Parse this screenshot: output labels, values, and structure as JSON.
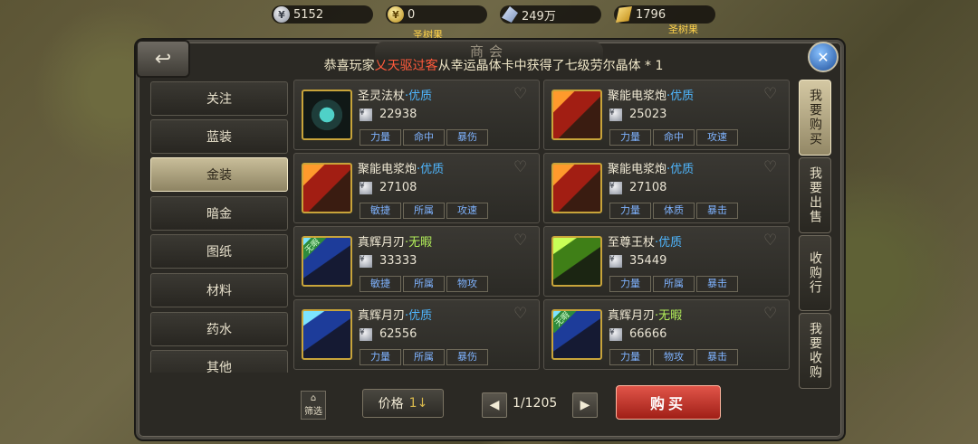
{
  "top_resources": [
    {
      "type": "silver",
      "value": "5152"
    },
    {
      "type": "gold",
      "value": "0"
    },
    {
      "type": "crystal",
      "value": "249万"
    },
    {
      "type": "goldbar",
      "value": "1796"
    }
  ],
  "labels": {
    "sacred_tree_left": "圣树果",
    "sacred_tree_right": "圣树果"
  },
  "panel": {
    "title": "商会",
    "announcement_prefix": "恭喜玩家",
    "announcement_player": "乂天驱过客",
    "announcement_suffix": "从幸运晶体卡中获得了七级劳尔晶体 * 1"
  },
  "left_nav": {
    "items": [
      {
        "label": "关注",
        "active": false
      },
      {
        "label": "蓝装",
        "active": false
      },
      {
        "label": "金装",
        "active": true
      },
      {
        "label": "暗金",
        "active": false
      },
      {
        "label": "图纸",
        "active": false
      },
      {
        "label": "材料",
        "active": false
      },
      {
        "label": "药水",
        "active": false
      },
      {
        "label": "其他",
        "active": false
      }
    ]
  },
  "right_tabs": [
    {
      "label": "我要购买",
      "active": true
    },
    {
      "label": "我要出售",
      "active": false
    },
    {
      "label": "收购行",
      "active": false
    },
    {
      "label": "我要收购",
      "active": false
    }
  ],
  "items": [
    {
      "name": "圣灵法杖",
      "quality": "优质",
      "quality_type": "good",
      "price": "22938",
      "attrs": [
        "力量",
        "命中",
        "暴伤"
      ],
      "icon": "staff-icon",
      "icon_style": "cyan",
      "tag": ""
    },
    {
      "name": "聚能电浆炮",
      "quality": "优质",
      "quality_type": "good",
      "price": "25023",
      "attrs": [
        "力量",
        "命中",
        "攻速"
      ],
      "icon": "plasma-cannon-icon",
      "icon_style": "red",
      "tag": ""
    },
    {
      "name": "聚能电浆炮",
      "quality": "优质",
      "quality_type": "good",
      "price": "27108",
      "attrs": [
        "敏捷",
        "所属",
        "攻速"
      ],
      "icon": "plasma-cannon-icon",
      "icon_style": "red",
      "tag": ""
    },
    {
      "name": "聚能电浆炮",
      "quality": "优质",
      "quality_type": "good",
      "price": "27108",
      "attrs": [
        "力量",
        "体质",
        "暴击"
      ],
      "icon": "plasma-cannon-icon",
      "icon_style": "red",
      "tag": ""
    },
    {
      "name": "真辉月刃",
      "quality": "无暇",
      "quality_type": "perfect",
      "price": "33333",
      "attrs": [
        "敏捷",
        "所属",
        "物攻"
      ],
      "icon": "moon-blade-icon",
      "icon_style": "blue",
      "tag": "无暇"
    },
    {
      "name": "至尊王杖",
      "quality": "优质",
      "quality_type": "good",
      "price": "35449",
      "attrs": [
        "力量",
        "所属",
        "暴击"
      ],
      "icon": "royal-scepter-icon",
      "icon_style": "green",
      "tag": ""
    },
    {
      "name": "真辉月刃",
      "quality": "优质",
      "quality_type": "good",
      "price": "62556",
      "attrs": [
        "力量",
        "所属",
        "暴伤"
      ],
      "icon": "moon-blade-icon",
      "icon_style": "blue",
      "tag": ""
    },
    {
      "name": "真辉月刃",
      "quality": "无暇",
      "quality_type": "perfect",
      "price": "66666",
      "attrs": [
        "力量",
        "物攻",
        "暴击"
      ],
      "icon": "moon-blade-icon",
      "icon_style": "blue",
      "tag": "无暇"
    }
  ],
  "bottom": {
    "filter_label": "筛选",
    "sort_label": "价格",
    "sort_arrow": "1↓",
    "pager": "1/1205",
    "buy_label": "购买"
  },
  "colors": {
    "quality_good": "#4fb7ff",
    "quality_perfect": "#b3ef5a",
    "buy_button": "#c53226"
  }
}
